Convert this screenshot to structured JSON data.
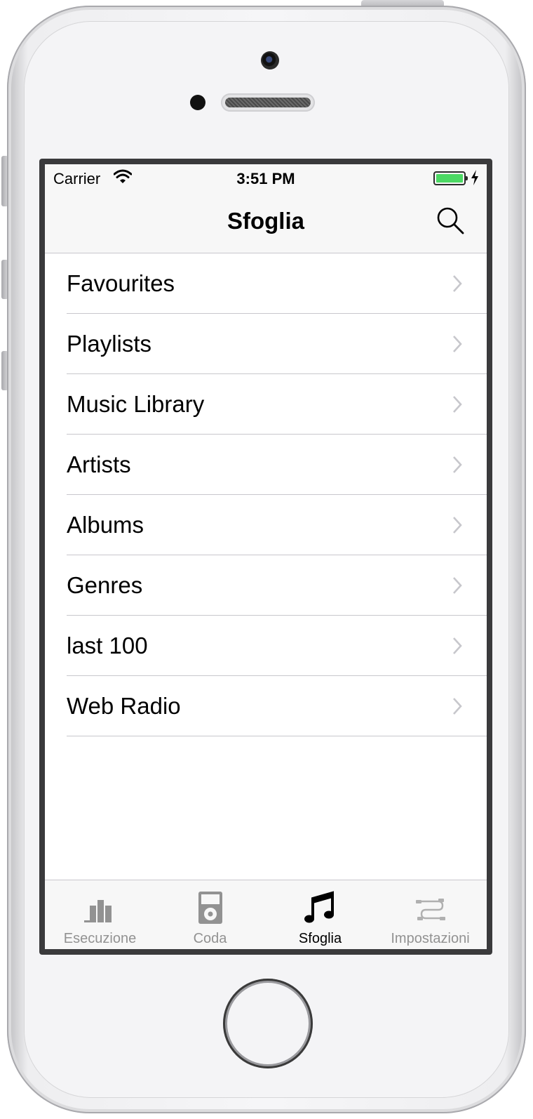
{
  "status_bar": {
    "carrier": "Carrier",
    "time": "3:51 PM"
  },
  "nav": {
    "title": "Sfoglia",
    "search_icon": "search-icon"
  },
  "list": {
    "items": [
      {
        "label": "Favourites"
      },
      {
        "label": "Playlists"
      },
      {
        "label": "Music Library"
      },
      {
        "label": "Artists"
      },
      {
        "label": "Albums"
      },
      {
        "label": "Genres"
      },
      {
        "label": "last 100"
      },
      {
        "label": "Web Radio"
      }
    ]
  },
  "tab_bar": {
    "tabs": [
      {
        "label": "Esecuzione",
        "icon": "bar-chart-icon",
        "active": false
      },
      {
        "label": "Coda",
        "icon": "ipod-icon",
        "active": false
      },
      {
        "label": "Sfoglia",
        "icon": "music-note-icon",
        "active": true
      },
      {
        "label": "Impostazioni",
        "icon": "cables-icon",
        "active": false
      }
    ]
  },
  "colors": {
    "battery": "#4cd964",
    "inactive_tab": "#929292",
    "separator": "#c8c7cc",
    "bar_background": "#f7f7f7"
  }
}
